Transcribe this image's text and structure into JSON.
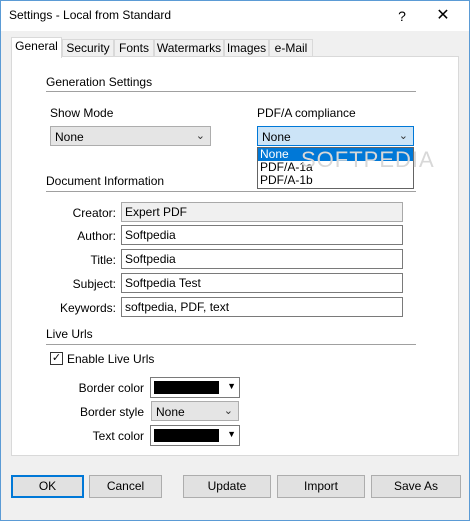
{
  "window": {
    "title": "Settings - Local from Standard",
    "help": "?",
    "close": "✕"
  },
  "tabs": [
    {
      "label": "General",
      "active": true
    },
    {
      "label": "Security"
    },
    {
      "label": "Fonts"
    },
    {
      "label": "Watermarks"
    },
    {
      "label": "Images"
    },
    {
      "label": "e-Mail"
    }
  ],
  "generation": {
    "title": "Generation Settings",
    "show_mode_label": "Show Mode",
    "show_mode_value": "None",
    "pdfa_label": "PDF/A compliance",
    "pdfa_value": "None",
    "pdfa_options": [
      "None",
      "PDF/A-1a",
      "PDF/A-1b"
    ]
  },
  "document": {
    "title": "Document Information",
    "creator_label": "Creator:",
    "creator_value": "Expert PDF",
    "author_label": "Author:",
    "author_value": "Softpedia",
    "title_label": "Title:",
    "title_value": "Softpedia",
    "subject_label": "Subject:",
    "subject_value": "Softpedia Test",
    "keywords_label": "Keywords:",
    "keywords_value": "softpedia, PDF, text"
  },
  "live_urls": {
    "title": "Live Urls",
    "enable_label": "Enable Live Urls",
    "enabled": true,
    "border_color_label": "Border color",
    "border_color": "#000000",
    "border_style_label": "Border style",
    "border_style_value": "None",
    "text_color_label": "Text color",
    "text_color": "#000000"
  },
  "buttons": {
    "ok": "OK",
    "cancel": "Cancel",
    "update": "Update",
    "import": "Import",
    "save_as": "Save As"
  },
  "watermark_text": "SOFTPEDIA",
  "colors": {
    "accent": "#0078d7",
    "selection": "#0078d7",
    "panel": "#ffffff",
    "chrome": "#f0f0f0"
  }
}
